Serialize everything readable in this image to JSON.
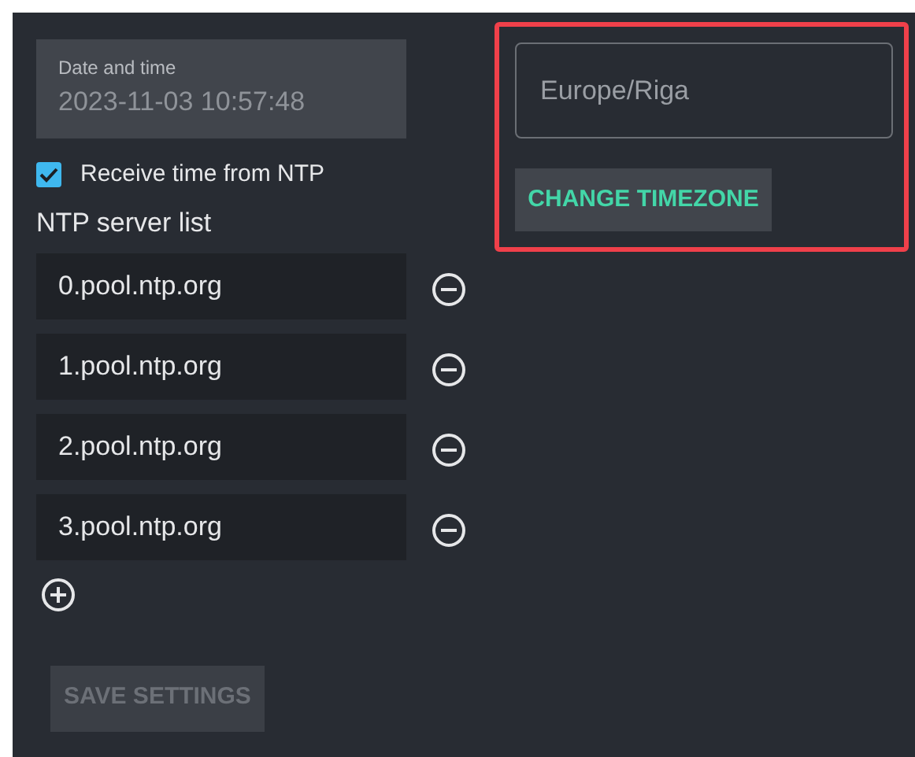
{
  "date_time": {
    "label": "Date and time",
    "value": "2023-11-03 10:57:48"
  },
  "ntp_checkbox": {
    "label": "Receive time from NTP",
    "checked": true
  },
  "ntp_servers": {
    "title": "NTP server list",
    "servers": [
      {
        "value": "0.pool.ntp.org"
      },
      {
        "value": "1.pool.ntp.org"
      },
      {
        "value": "2.pool.ntp.org"
      },
      {
        "value": "3.pool.ntp.org"
      }
    ]
  },
  "save_button": {
    "label": "SAVE SETTINGS",
    "disabled": true
  },
  "timezone": {
    "highlighted": true,
    "placeholder": "Europe/Riga",
    "button": "CHANGE TIMEZONE"
  }
}
